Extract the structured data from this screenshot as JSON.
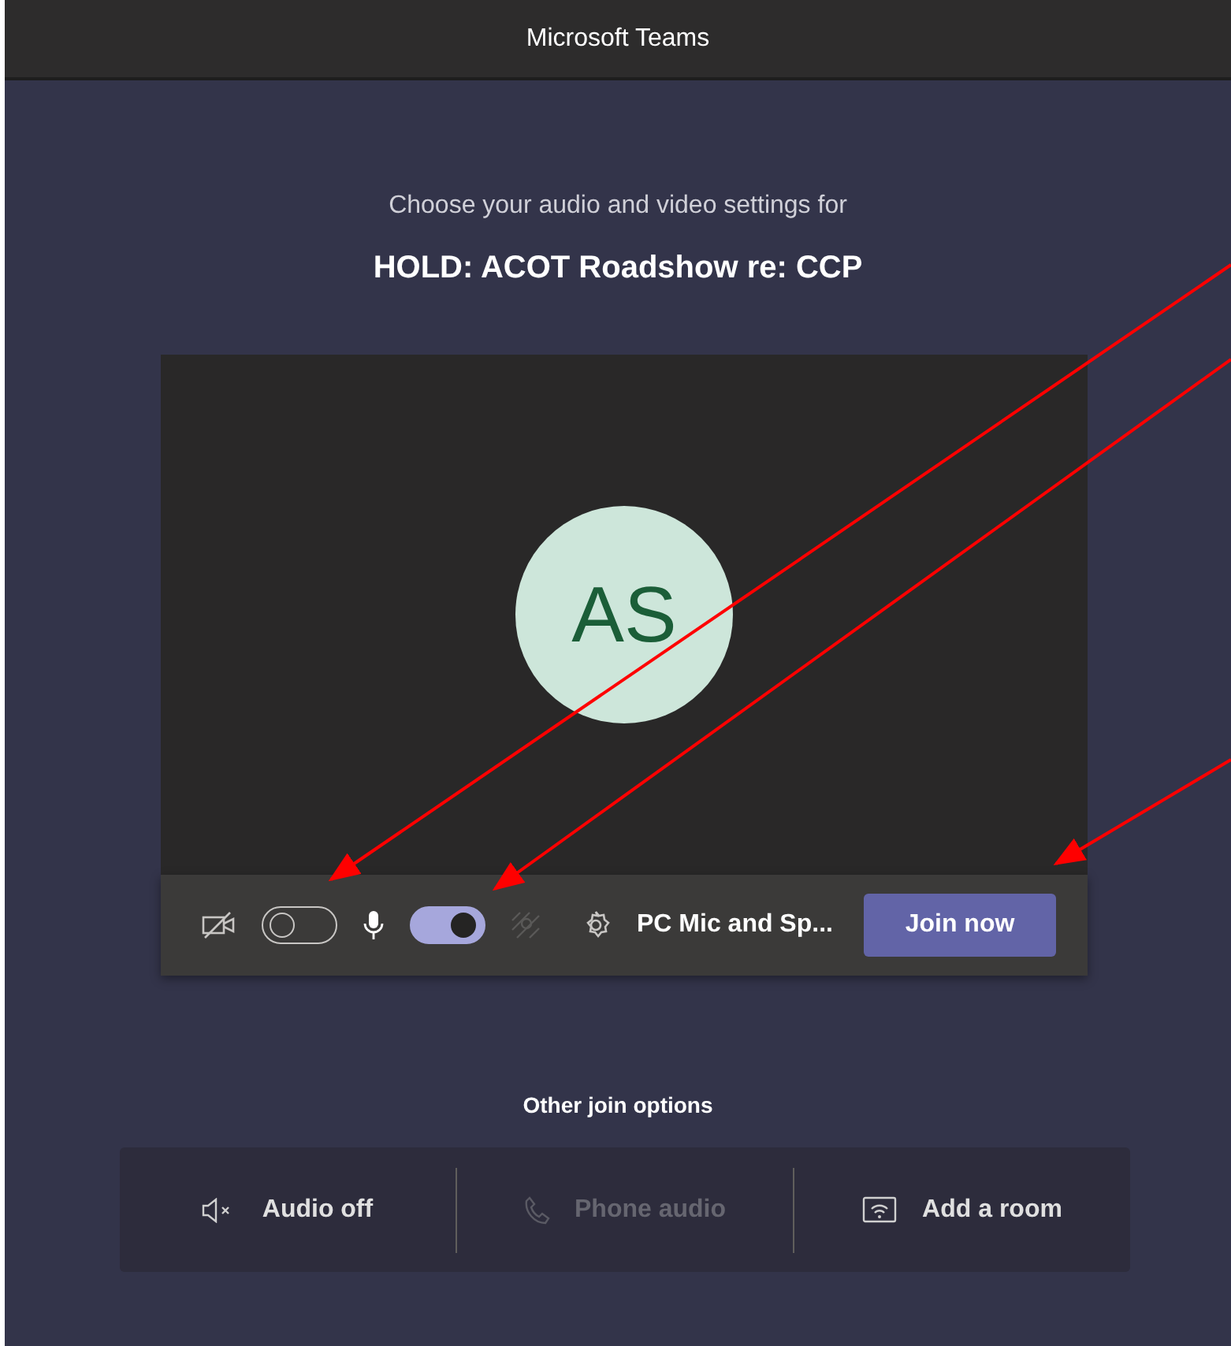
{
  "window": {
    "title": "Microsoft Teams"
  },
  "prompt": "Choose your audio and video settings for",
  "meeting_title": "HOLD: ACOT Roadshow re: CCP",
  "avatar": {
    "initials": "AS"
  },
  "controls": {
    "camera_on": false,
    "mic_on": true,
    "blur_disabled": true,
    "device": "PC Mic and Sp...",
    "join_button": "Join now"
  },
  "other_options": {
    "heading": "Other join options",
    "options": [
      {
        "kind": "audio-off",
        "label": "Audio off",
        "disabled": false
      },
      {
        "kind": "phone",
        "label": "Phone audio",
        "disabled": true
      },
      {
        "kind": "room",
        "label": "Add a room",
        "disabled": false
      }
    ]
  }
}
